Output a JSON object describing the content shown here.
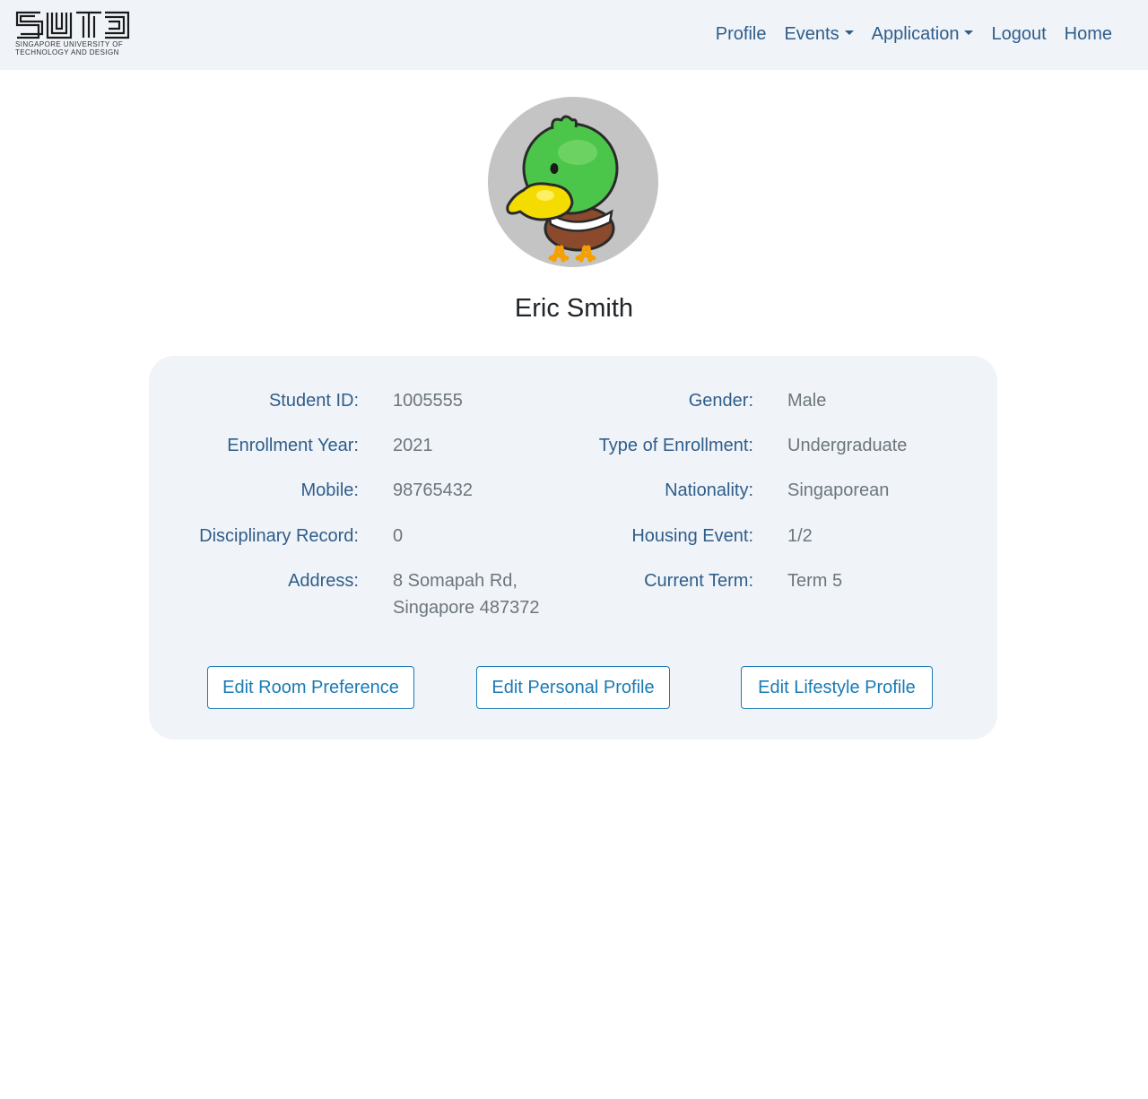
{
  "brand": {
    "logo_text": "SUTD",
    "subtitle_line1": "SINGAPORE UNIVERSITY OF",
    "subtitle_line2": "TECHNOLOGY AND DESIGN"
  },
  "nav": {
    "items": [
      {
        "label": "Profile",
        "dropdown": false
      },
      {
        "label": "Events",
        "dropdown": true
      },
      {
        "label": "Application",
        "dropdown": true
      },
      {
        "label": "Logout",
        "dropdown": false
      },
      {
        "label": "Home",
        "dropdown": false
      }
    ]
  },
  "profile": {
    "name": "Eric Smith",
    "avatar_icon": "duck-avatar-icon"
  },
  "details": {
    "left": [
      {
        "label": "Student ID:",
        "value": "1005555"
      },
      {
        "label": "Enrollment Year:",
        "value": "2021"
      },
      {
        "label": "Mobile:",
        "value": "98765432"
      },
      {
        "label": "Disciplinary Record:",
        "value": "0"
      },
      {
        "label": "Address:",
        "value_line1": "8 Somapah Rd,",
        "value_line2": "Singapore 487372"
      }
    ],
    "right": [
      {
        "label": "Gender:",
        "value": "Male"
      },
      {
        "label": "Type of Enrollment:",
        "value": "Undergraduate"
      },
      {
        "label": "Nationality:",
        "value": "Singaporean"
      },
      {
        "label": "Housing Event:",
        "value": "1/2"
      },
      {
        "label": "Current Term:",
        "value": "Term 5"
      }
    ]
  },
  "actions": {
    "edit_room": "Edit Room Preference",
    "edit_personal": "Edit Personal Profile",
    "edit_lifestyle": "Edit Lifestyle Profile"
  },
  "colors": {
    "nav_bg": "#f0f4f9",
    "link": "#2f5d8a",
    "value_text": "#6c757d",
    "button_accent": "#1a7bb5",
    "card_bg": "#f0f4f9"
  }
}
